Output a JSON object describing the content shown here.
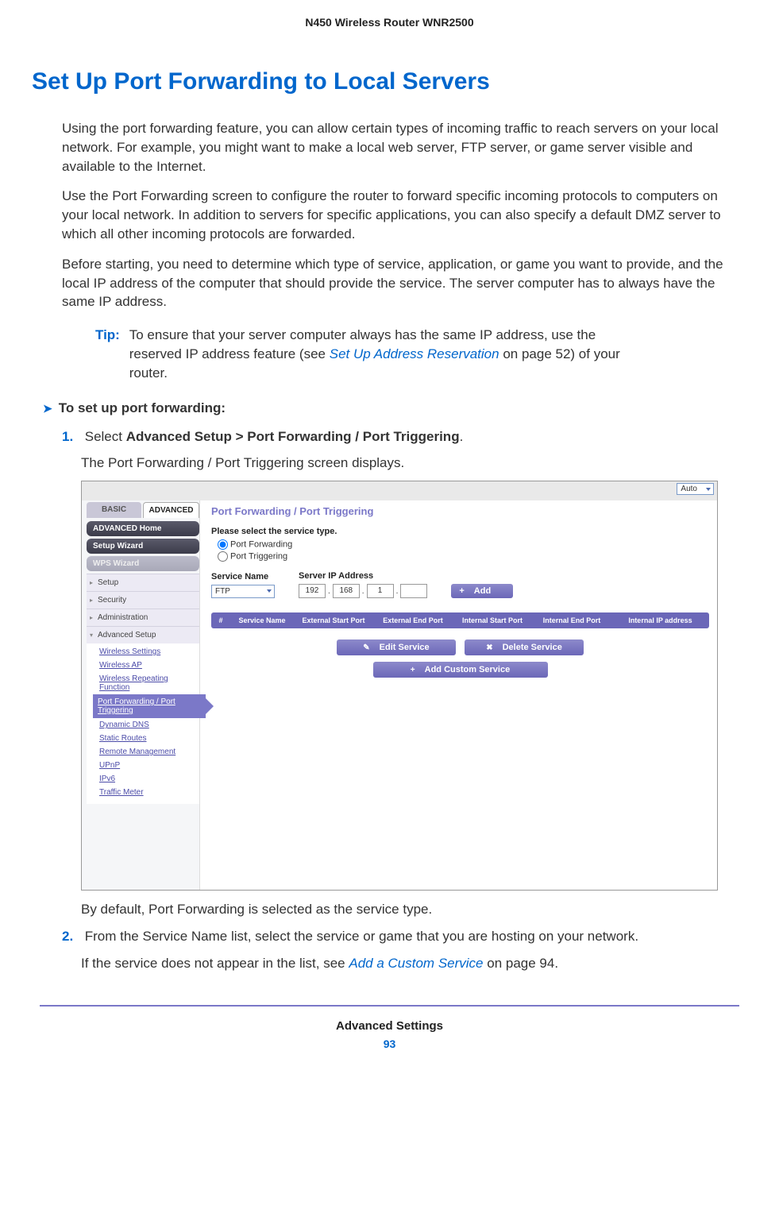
{
  "doc_header": "N450 Wireless Router WNR2500",
  "section_title": "Set Up Port Forwarding to Local Servers",
  "para1": "Using the port forwarding feature, you can allow certain types of incoming traffic to reach servers on your local network. For example, you might want to make a local web server, FTP server, or game server visible and available to the Internet.",
  "para2": "Use the Port Forwarding screen to configure the router to forward specific incoming protocols to computers on your local network. In addition to servers for specific applications, you can also specify a default DMZ server to which all other incoming protocols are forwarded.",
  "para3": "Before starting, you need to determine which type of service, application, or game you want to provide, and the local IP address of the computer that should provide the service. The server computer has to always have the same IP address.",
  "tip": {
    "label": "Tip:",
    "text_before_link": "To ensure that your server computer always has the same IP address, use the reserved IP address feature (see ",
    "link": "Set Up Address Reservation",
    "text_after_link": " on page 52) of your router."
  },
  "procedure_heading": "To set up port forwarding:",
  "step1": {
    "num": "1.",
    "text_before": "Select ",
    "bold": "Advanced Setup > Port Forwarding / Port Triggering",
    "text_after": ".",
    "sub": "The Port Forwarding / Port Triggering screen displays."
  },
  "screenshot": {
    "auto_select": "Auto",
    "tabs": {
      "basic": "BASIC",
      "advanced": "ADVANCED"
    },
    "nav": {
      "advanced_home": "ADVANCED Home",
      "setup_wizard": "Setup Wizard",
      "wps_wizard": "WPS Wizard",
      "setup": "Setup",
      "security": "Security",
      "administration": "Administration",
      "advanced_setup": "Advanced Setup",
      "sub": {
        "wireless_settings": "Wireless Settings",
        "wireless_ap": "Wireless AP",
        "wireless_repeating": "Wireless Repeating Function",
        "port_fwd": "Port Forwarding / Port Triggering",
        "dynamic_dns": "Dynamic DNS",
        "static_routes": "Static Routes",
        "remote_mgmt": "Remote Management",
        "upnp": "UPnP",
        "ipv6": "IPv6",
        "traffic_meter": "Traffic Meter"
      }
    },
    "page_title": "Port Forwarding / Port Triggering",
    "service_type_label": "Please select the service type.",
    "radio_fwd": "Port Forwarding",
    "radio_trig": "Port Triggering",
    "service_name_label": "Service Name",
    "service_name_value": "FTP",
    "server_ip_label": "Server IP Address",
    "ip": {
      "o1": "192",
      "o2": "168",
      "o3": "1",
      "o4": ""
    },
    "add_btn": "Add",
    "table_headers": {
      "num": "#",
      "service_name": "Service Name",
      "ext_start": "External Start Port",
      "ext_end": "External End Port",
      "int_start": "Internal Start Port",
      "int_end": "Internal End Port",
      "int_ip": "Internal IP address"
    },
    "edit_service": "Edit Service",
    "delete_service": "Delete Service",
    "add_custom": "Add Custom Service"
  },
  "step1_after": "By default, Port Forwarding is selected as the service type.",
  "step2": {
    "num": "2.",
    "text": "From the Service Name list, select the service or game that you are hosting on your network.",
    "sub_before": "If the service does not appear in the list, see ",
    "sub_link": "Add a Custom Service",
    "sub_after": " on page 94."
  },
  "footer": {
    "title": "Advanced Settings",
    "page": "93"
  }
}
